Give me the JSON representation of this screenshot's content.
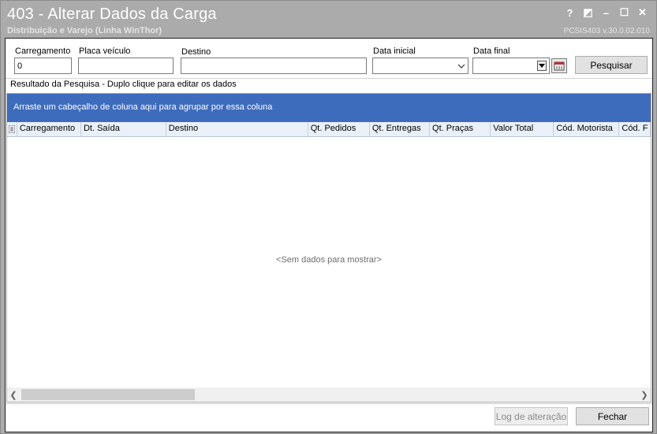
{
  "window": {
    "title": "403 - Alterar Dados da Carga",
    "subtitle": "Distribuição e Varejo (Linha WinThor)",
    "version": "PCSIS403  v.30.0.02.010",
    "controls": [
      "?",
      "◩",
      "–",
      "☐",
      "✕"
    ]
  },
  "form": {
    "carregamento": {
      "label": "Carregamento",
      "value": "0"
    },
    "placa": {
      "label": "Placa veículo",
      "value": ""
    },
    "destino": {
      "label": "Destino",
      "value": ""
    },
    "data_inicial": {
      "label": "Data inicial",
      "value": ""
    },
    "data_final": {
      "label": "Data final",
      "value": ""
    },
    "pesquisar_label": "Pesquisar"
  },
  "results": {
    "title": "Resultado da Pesquisa - Duplo clique para editar os dados",
    "group_hint": "Arraste um cabeçalho de coluna aqui para agrupar por essa coluna",
    "columns": [
      "Carregamento",
      "Dt. Saída",
      "Destino",
      "Qt. Pedidos",
      "Qt. Entregas",
      "Qt. Praças",
      "Valor Total",
      "Cód. Motorista",
      "Cód. F"
    ],
    "empty_text": "<Sem dados para mostrar>"
  },
  "footer": {
    "log_label": "Log de alteração",
    "fechar_label": "Fechar"
  },
  "colors": {
    "titlebar": "#ababab",
    "groupbar": "#3e6cbd",
    "column_header": "#eaf0f8"
  }
}
